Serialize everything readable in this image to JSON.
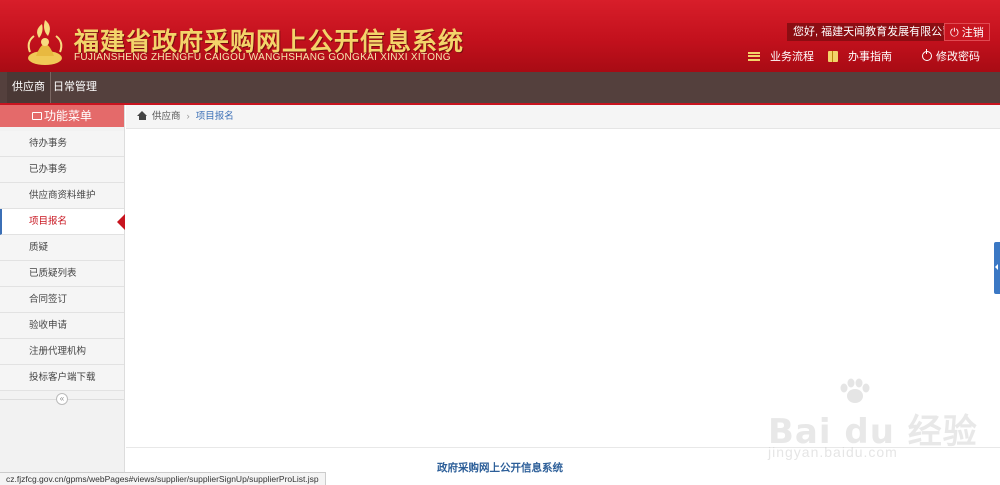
{
  "header": {
    "title_cn": "福建省政府采购网上公开信息系统",
    "title_en": "FUJIANSHENG ZHENGFU CAIGOU WANGHSHANG GONGKAI XINXI XITONG",
    "greeting": "您好,  福建天闻教育发展有限公司",
    "logout": "注销",
    "links": [
      {
        "label": "业务流程",
        "icon": "list-icon"
      },
      {
        "label": "办事指南",
        "icon": "book-icon"
      },
      {
        "label": "修改密码",
        "icon": "power-icon"
      }
    ]
  },
  "topnav": {
    "tabs": [
      "供应商",
      "日常管理"
    ]
  },
  "sidebar": {
    "heading": "功能菜单",
    "items": [
      {
        "label": "待办事务"
      },
      {
        "label": "已办事务"
      },
      {
        "label": "供应商资料维护"
      },
      {
        "label": "项目报名",
        "active": true
      },
      {
        "label": "质疑"
      },
      {
        "label": "已质疑列表"
      },
      {
        "label": "合同签订"
      },
      {
        "label": "验收申请"
      },
      {
        "label": "注册代理机构"
      },
      {
        "label": "投标客户端下载"
      }
    ]
  },
  "breadcrumb": {
    "root": "供应商",
    "current": "项目报名"
  },
  "footer": {
    "text": "政府采购网上公开信息系统"
  },
  "statusbar": {
    "url": "cz.fjzfcg.gov.cn/gpms/webPages#views/supplier/supplierSignUp/supplierProList.jsp"
  },
  "watermark": {
    "main": "Bai du 经验",
    "sub": "jingyan.baidu.com"
  },
  "colors": {
    "header_red": "#c3111d",
    "title_gold": "#f3d46a",
    "nav_brown": "#54403d",
    "accent_blue": "#3b6fb6"
  }
}
